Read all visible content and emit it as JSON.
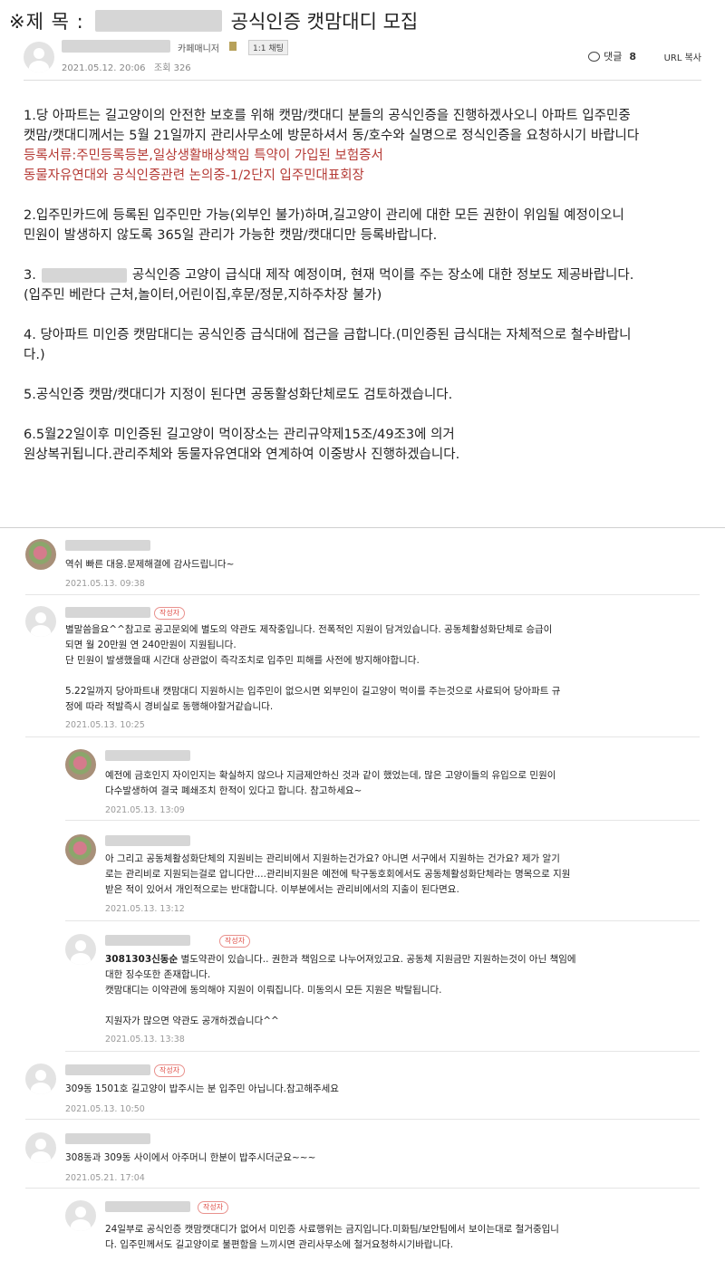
{
  "post": {
    "title_prefix": "※제 목 :",
    "title": "공식인증 캣맘대디 모집",
    "author_role": "카페매니저",
    "chat_label": "1:1 채팅",
    "date": "2021.05.12. 20:06",
    "views_label": "조회 326",
    "comment_label": "댓글",
    "comment_count": "8",
    "url_copy_label": "URL 복사",
    "paragraphs": [
      {
        "lines": [
          "1.당 아파트는 길고양이의 안전한 보호를 위해 캣맘/캣대디 분들의 공식인증을 진행하겠사오니 아파트 입주민중",
          "캣맘/캣대디께서는 5월 21일까지 관리사무소에 방문하셔서 동/호수와 실명으로 정식인증을 요청하시기 바랍니다"
        ],
        "red_lines": [
          "등록서류:주민등록등본,일상생활배상책임 특약이 가입된 보험증서",
          "동물자유연대와 공식인증관련 논의중-1/2단지 입주민대표회장"
        ]
      },
      {
        "lines": [
          "2.입주민카드에 등록된 입주민만 가능(외부인 불가)하며,길고양이 관리에 대한 모든 권한이 위임될 예정이오니",
          "민원이 발생하지 않도록 365일 관리가 가능한 캣맘/캣대디만 등록바랍니다."
        ]
      },
      {
        "line1_prefix": "3.",
        "line1_rest": "공식인증 고양이 급식대 제작 예정이며, 현재 먹이를 주는 장소에 대한 정보도 제공바랍니다.",
        "lines": [
          "(입주민 베란다 근처,놀이터,어린이집,후문/정문,지하주차장 불가)"
        ]
      },
      {
        "lines": [
          "4. 당아파트 미인증 캣맘대디는 공식인증 급식대에 접근을 금합니다.(미인증된 급식대는 자체적으로 철수바랍니",
          "다.)"
        ]
      },
      {
        "lines": [
          "5.공식인증 캣맘/캣대디가 지정이 된다면 공동활성화단체로도 검토하겠습니다."
        ]
      },
      {
        "lines": [
          "6.5월22일이후 미인증된 길고양이 먹이장소는 관리규약제15조/49조3에  의거",
          "원상복귀됩니다.관리주체와 동물자유연대와 연계하여 이중방사 진행하겠습니다."
        ]
      }
    ]
  },
  "comments": {
    "author_badge": "작성자",
    "items": [
      {
        "lines": [
          "역쉬 빠른 대응.문제해결에 감사드립니다~"
        ],
        "date": "2021.05.13. 09:38"
      },
      {
        "lines": [
          "별말씀을요^^참고로 공고문외에 별도의 약관도 제작중입니다. 전폭적인 지원이 담겨있습니다. 공동체활성화단체로 승급이",
          "되면 월 20만원 연 240만원이 지원됩니다.",
          "단 민원이 발생했을때 시간대 상관없이 즉각조치로 입주민 피해를 사전에 방지해야합니다.",
          "",
          "5.22일까지 당아파트내 캣맘대디 지원하시는 입주민이 없으시면 외부인이 길고양이 먹이를 주는것으로 사료되어 당아파트 규",
          "정에 따라 적발즉시 경비실로 동행해야할거같습니다."
        ],
        "date": "2021.05.13. 10:25"
      },
      {
        "lines": [
          "예전에 금호인지 자이인지는 확실하지 않으나 지금제안하신 것과 같이 했었는데, 많은 고양이들의 유입으로 민원이",
          "다수발생하여 결국 폐쇄조치 한적이 있다고 합니다. 참고하세요~"
        ],
        "date": "2021.05.13. 13:09"
      },
      {
        "lines": [
          "아 그리고 공동체활성화단체의 지원비는 관리비에서 지원하는건가요? 아니면 서구에서 지원하는 건가요? 제가 알기",
          "로는 관리비로 지원되는걸로 압니다만....관리비지원은 예전에 탁구동호회에서도 공동체활성화단체라는 명목으로 지원",
          "받은 적이 있어서 개인적으로는 반대합니다. 이부분에서는 관리비에서의 지출이 된다면요."
        ],
        "date": "2021.05.13. 13:12"
      },
      {
        "mention": "3081303신동순",
        "lines": [
          " 별도약관이 있습니다.. 권한과 책임으로 나누어져있고요. 공동체 지원금만 지원하는것이 아닌 책임에",
          "대한 징수또한 존재합니다.",
          "캣맘대디는 이약관에 동의해야 지원이 이뤄집니다. 미동의시 모든 지원은 박탈됩니다.",
          "",
          "지원자가 많으면 약관도 공개하겠습니다^^"
        ],
        "date": "2021.05.13. 13:38"
      },
      {
        "lines": [
          "309동 1501호 길고양이 밥주시는 분 입주민 아닙니다.참고해주세요"
        ],
        "date": "2021.05.13. 10:50"
      },
      {
        "lines": [
          "308동과 309동 사이에서 아주머니 한분이 밥주시더군요~~~"
        ],
        "date": "2021.05.21. 17:04"
      },
      {
        "lines": [
          "24일부로 공식인증 캣맘캣대디가 없어서 미인증 사료행위는 금지입니다.미화팀/보안팀에서 보이는대로 철거중입니",
          "다. 입주민께서도 길고양이로 불편함을 느끼시면 관리사무소에 철거요청하시기바랍니다."
        ],
        "date": ""
      }
    ]
  }
}
